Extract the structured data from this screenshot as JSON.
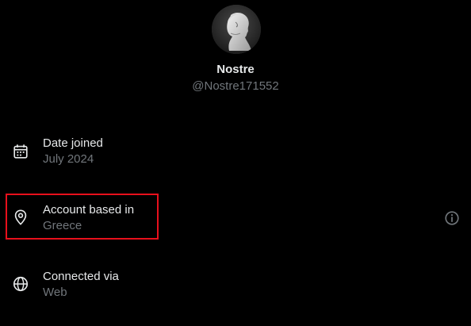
{
  "profile": {
    "display_name": "Nostre",
    "handle": "@Nostre171552"
  },
  "details": {
    "date_joined": {
      "label": "Date joined",
      "value": "July 2024",
      "icon": "calendar-icon"
    },
    "account_based_in": {
      "label": "Account based in",
      "value": "Greece",
      "icon": "location-pin-icon",
      "highlighted": true
    },
    "connected_via": {
      "label": "Connected via",
      "value": "Web",
      "icon": "globe-icon"
    }
  },
  "colors": {
    "background": "#000000",
    "primary_text": "#e7e9ea",
    "secondary_text": "#71767b",
    "highlight_border": "#e8101c"
  },
  "icons": {
    "info": "info-icon"
  }
}
